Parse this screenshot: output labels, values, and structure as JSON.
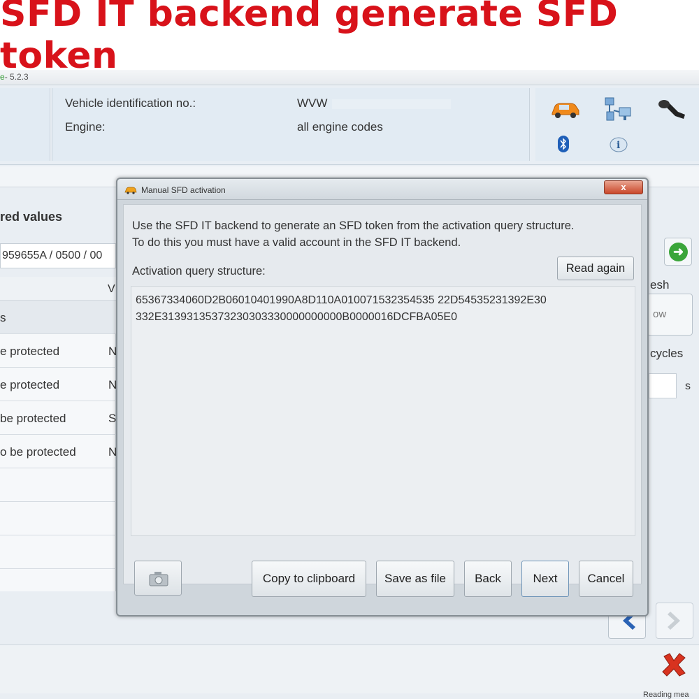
{
  "banner": {
    "title": "SFD IT backend generate SFD token"
  },
  "app": {
    "version_prefix": "e",
    "version": "- 5.2.3",
    "vehicle": {
      "vin_label": "Vehicle identification no.:",
      "vin_value": "WVW",
      "engine_label": "Engine:",
      "engine_value": "all engine codes"
    },
    "icons": [
      "car-icon",
      "network-icon",
      "key-icon",
      "bluetooth-icon",
      "info-icon"
    ],
    "background": {
      "section_title": "red values",
      "part_number": "959655A / 0500 / 00",
      "col_v": "V",
      "rows": [
        {
          "text": "s",
          "c2": ""
        },
        {
          "text": "e protected",
          "c2": "N"
        },
        {
          "text": "e protected",
          "c2": "N"
        },
        {
          "text": "be protected",
          "c2": "S"
        },
        {
          "text": "o be protected",
          "c2": "N"
        }
      ],
      "refresh_label": "esh",
      "now_button": "ow",
      "cycles_label": "cycles",
      "seconds_label": "s",
      "status_text": "Reading mea"
    }
  },
  "dialog": {
    "title": "Manual SFD activation",
    "close_label": "x",
    "description_line1": "Use the SFD IT backend to generate an SFD token from the activation query structure.",
    "description_line2": "To do this you must have a valid account in the SFD IT backend.",
    "query_label": "Activation query structure:",
    "read_again": "Read again",
    "query_value_line1": "65367334060D2B06010401990A8D110A010071532354535 22D54535231392E30",
    "query_value_line2": "332E31393135373230303330000000000B0000016DCFBA05E0",
    "buttons": {
      "copy": "Copy to clipboard",
      "save": "Save as file",
      "back": "Back",
      "next": "Next",
      "cancel": "Cancel"
    }
  },
  "colors": {
    "banner_red": "#d8121a",
    "accent_green": "#3aa53a",
    "nav_blue": "#2b63b5",
    "cancel_red": "#d8331f"
  }
}
